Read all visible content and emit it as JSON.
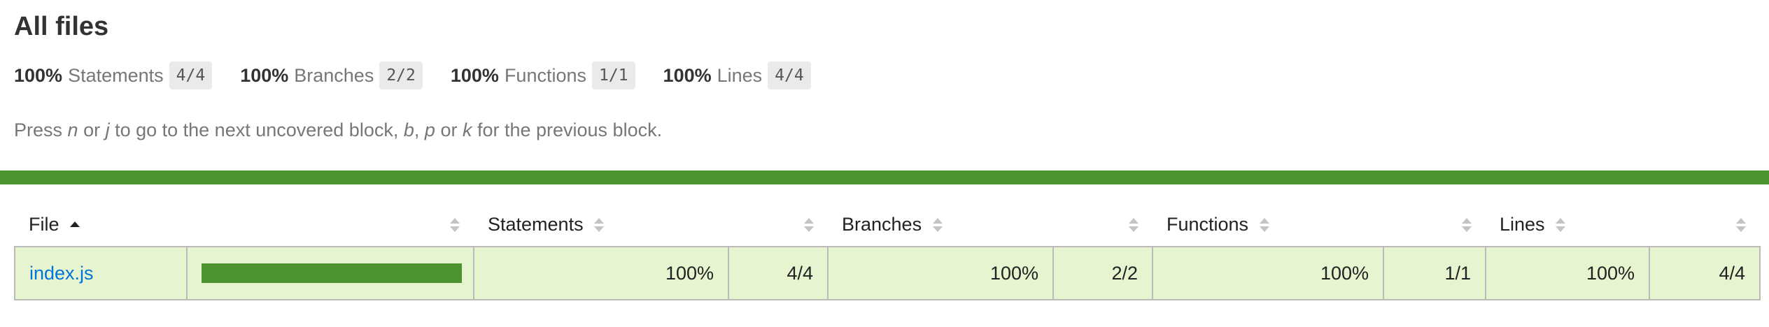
{
  "title": "All files",
  "summary": [
    {
      "pct": "100%",
      "label": "Statements",
      "fraction": "4/4"
    },
    {
      "pct": "100%",
      "label": "Branches",
      "fraction": "2/2"
    },
    {
      "pct": "100%",
      "label": "Functions",
      "fraction": "1/1"
    },
    {
      "pct": "100%",
      "label": "Lines",
      "fraction": "4/4"
    }
  ],
  "hint": {
    "p1": "Press ",
    "k1": "n",
    "p2": " or ",
    "k2": "j",
    "p3": " to go to the next uncovered block, ",
    "k3": "b",
    "p4": ", ",
    "k4": "p",
    "p5": " or ",
    "k5": "k",
    "p6": " for the previous block."
  },
  "table": {
    "headers": {
      "file": "File",
      "statements": "Statements",
      "branches": "Branches",
      "functions": "Functions",
      "lines": "Lines"
    },
    "rows": [
      {
        "file": "index.js",
        "coverage_fraction": 1.0,
        "statements_pct": "100%",
        "statements_frac": "4/4",
        "branches_pct": "100%",
        "branches_frac": "2/2",
        "functions_pct": "100%",
        "functions_frac": "1/1",
        "lines_pct": "100%",
        "lines_frac": "4/4"
      }
    ]
  },
  "colors": {
    "high_coverage_bar": "#4d9330",
    "high_coverage_row": "#e6f5d0",
    "link": "#0074d9"
  },
  "icons": [
    "sort-ascending-icon",
    "sort-icon"
  ]
}
